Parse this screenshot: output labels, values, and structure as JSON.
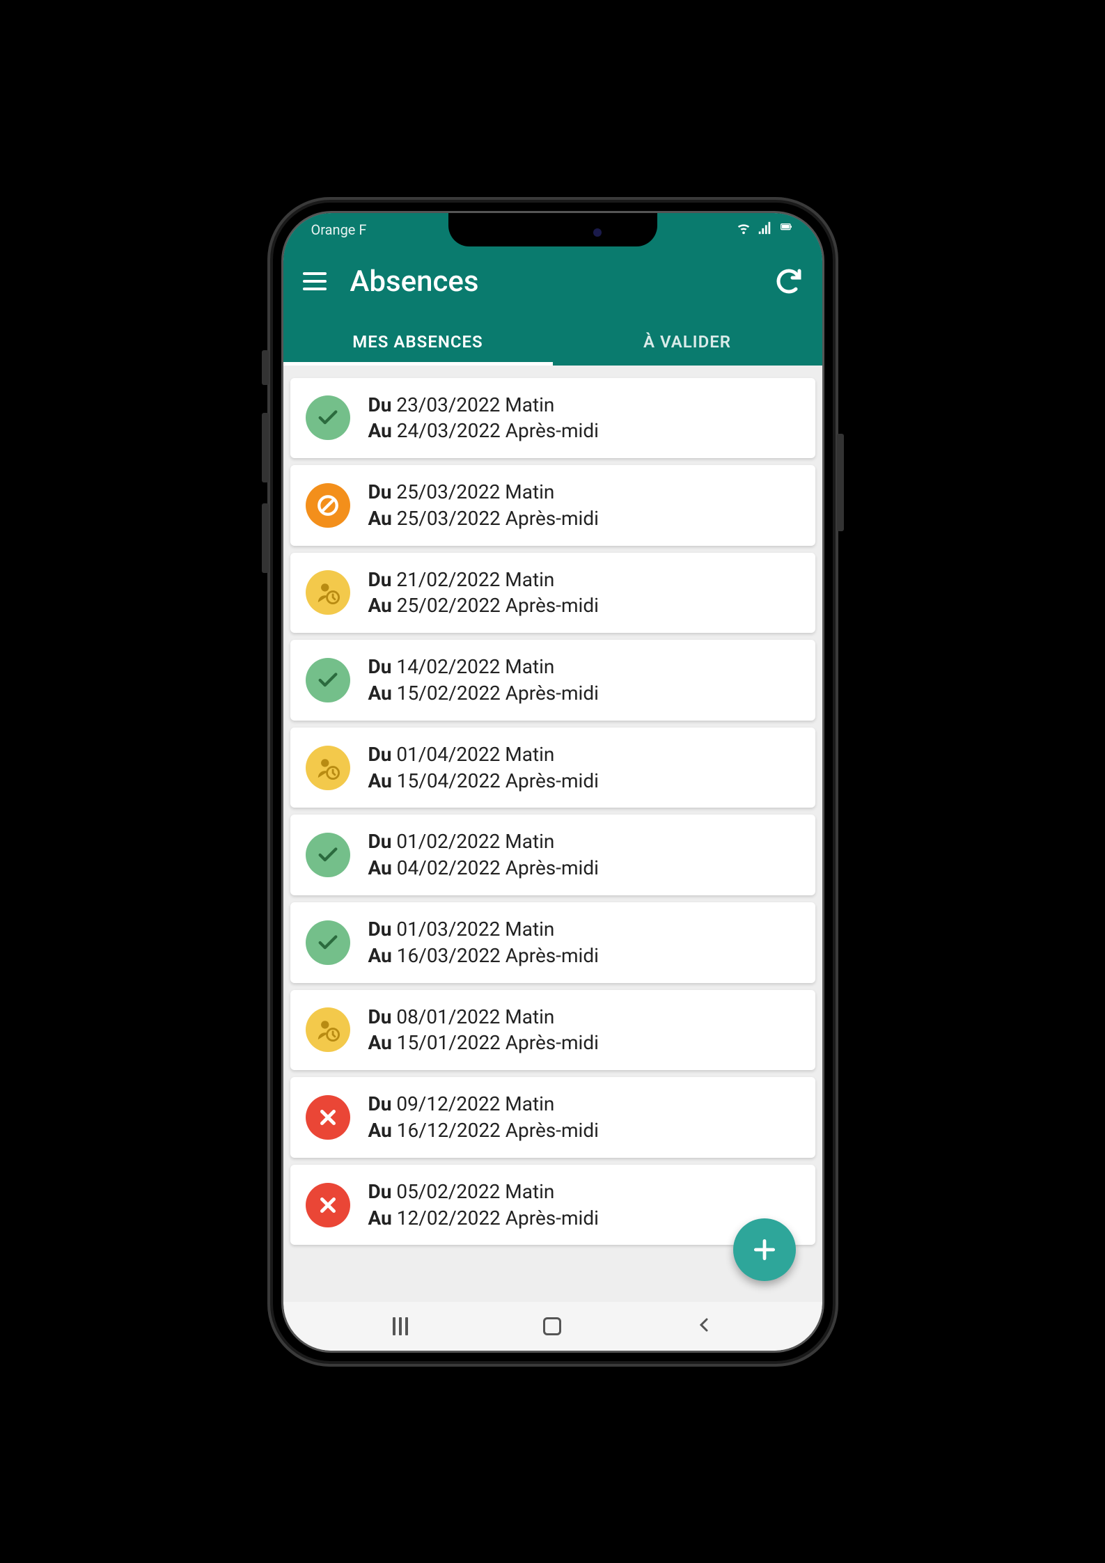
{
  "status_bar": {
    "carrier": "Orange F"
  },
  "header": {
    "title": "Absences"
  },
  "tabs": {
    "my_absences": "MES ABSENCES",
    "to_validate": "À VALIDER"
  },
  "labels": {
    "from": "Du",
    "to": "Au"
  },
  "colors": {
    "primary": "#0a7b6e",
    "approved": "#74bf8a",
    "cancelled": "#f38f1b",
    "pending": "#f3c94b",
    "rejected": "#ea4636",
    "fab": "#2ea69a"
  },
  "absences": [
    {
      "status": "approved",
      "from_date": "23/03/2022",
      "from_part": "Matin",
      "to_date": "24/03/2022",
      "to_part": "Après-midi"
    },
    {
      "status": "cancelled",
      "from_date": "25/03/2022",
      "from_part": "Matin",
      "to_date": "25/03/2022",
      "to_part": "Après-midi"
    },
    {
      "status": "pending",
      "from_date": "21/02/2022",
      "from_part": "Matin",
      "to_date": "25/02/2022",
      "to_part": "Après-midi"
    },
    {
      "status": "approved",
      "from_date": "14/02/2022",
      "from_part": "Matin",
      "to_date": "15/02/2022",
      "to_part": "Après-midi"
    },
    {
      "status": "pending",
      "from_date": "01/04/2022",
      "from_part": "Matin",
      "to_date": "15/04/2022",
      "to_part": "Après-midi"
    },
    {
      "status": "approved",
      "from_date": "01/02/2022",
      "from_part": "Matin",
      "to_date": "04/02/2022",
      "to_part": "Après-midi"
    },
    {
      "status": "approved",
      "from_date": "01/03/2022",
      "from_part": "Matin",
      "to_date": "16/03/2022",
      "to_part": "Après-midi"
    },
    {
      "status": "pending",
      "from_date": "08/01/2022",
      "from_part": "Matin",
      "to_date": "15/01/2022",
      "to_part": "Après-midi"
    },
    {
      "status": "rejected",
      "from_date": "09/12/2022",
      "from_part": "Matin",
      "to_date": "16/12/2022",
      "to_part": "Après-midi"
    },
    {
      "status": "rejected",
      "from_date": "05/02/2022",
      "from_part": "Matin",
      "to_date": "12/02/2022",
      "to_part": "Après-midi"
    }
  ]
}
